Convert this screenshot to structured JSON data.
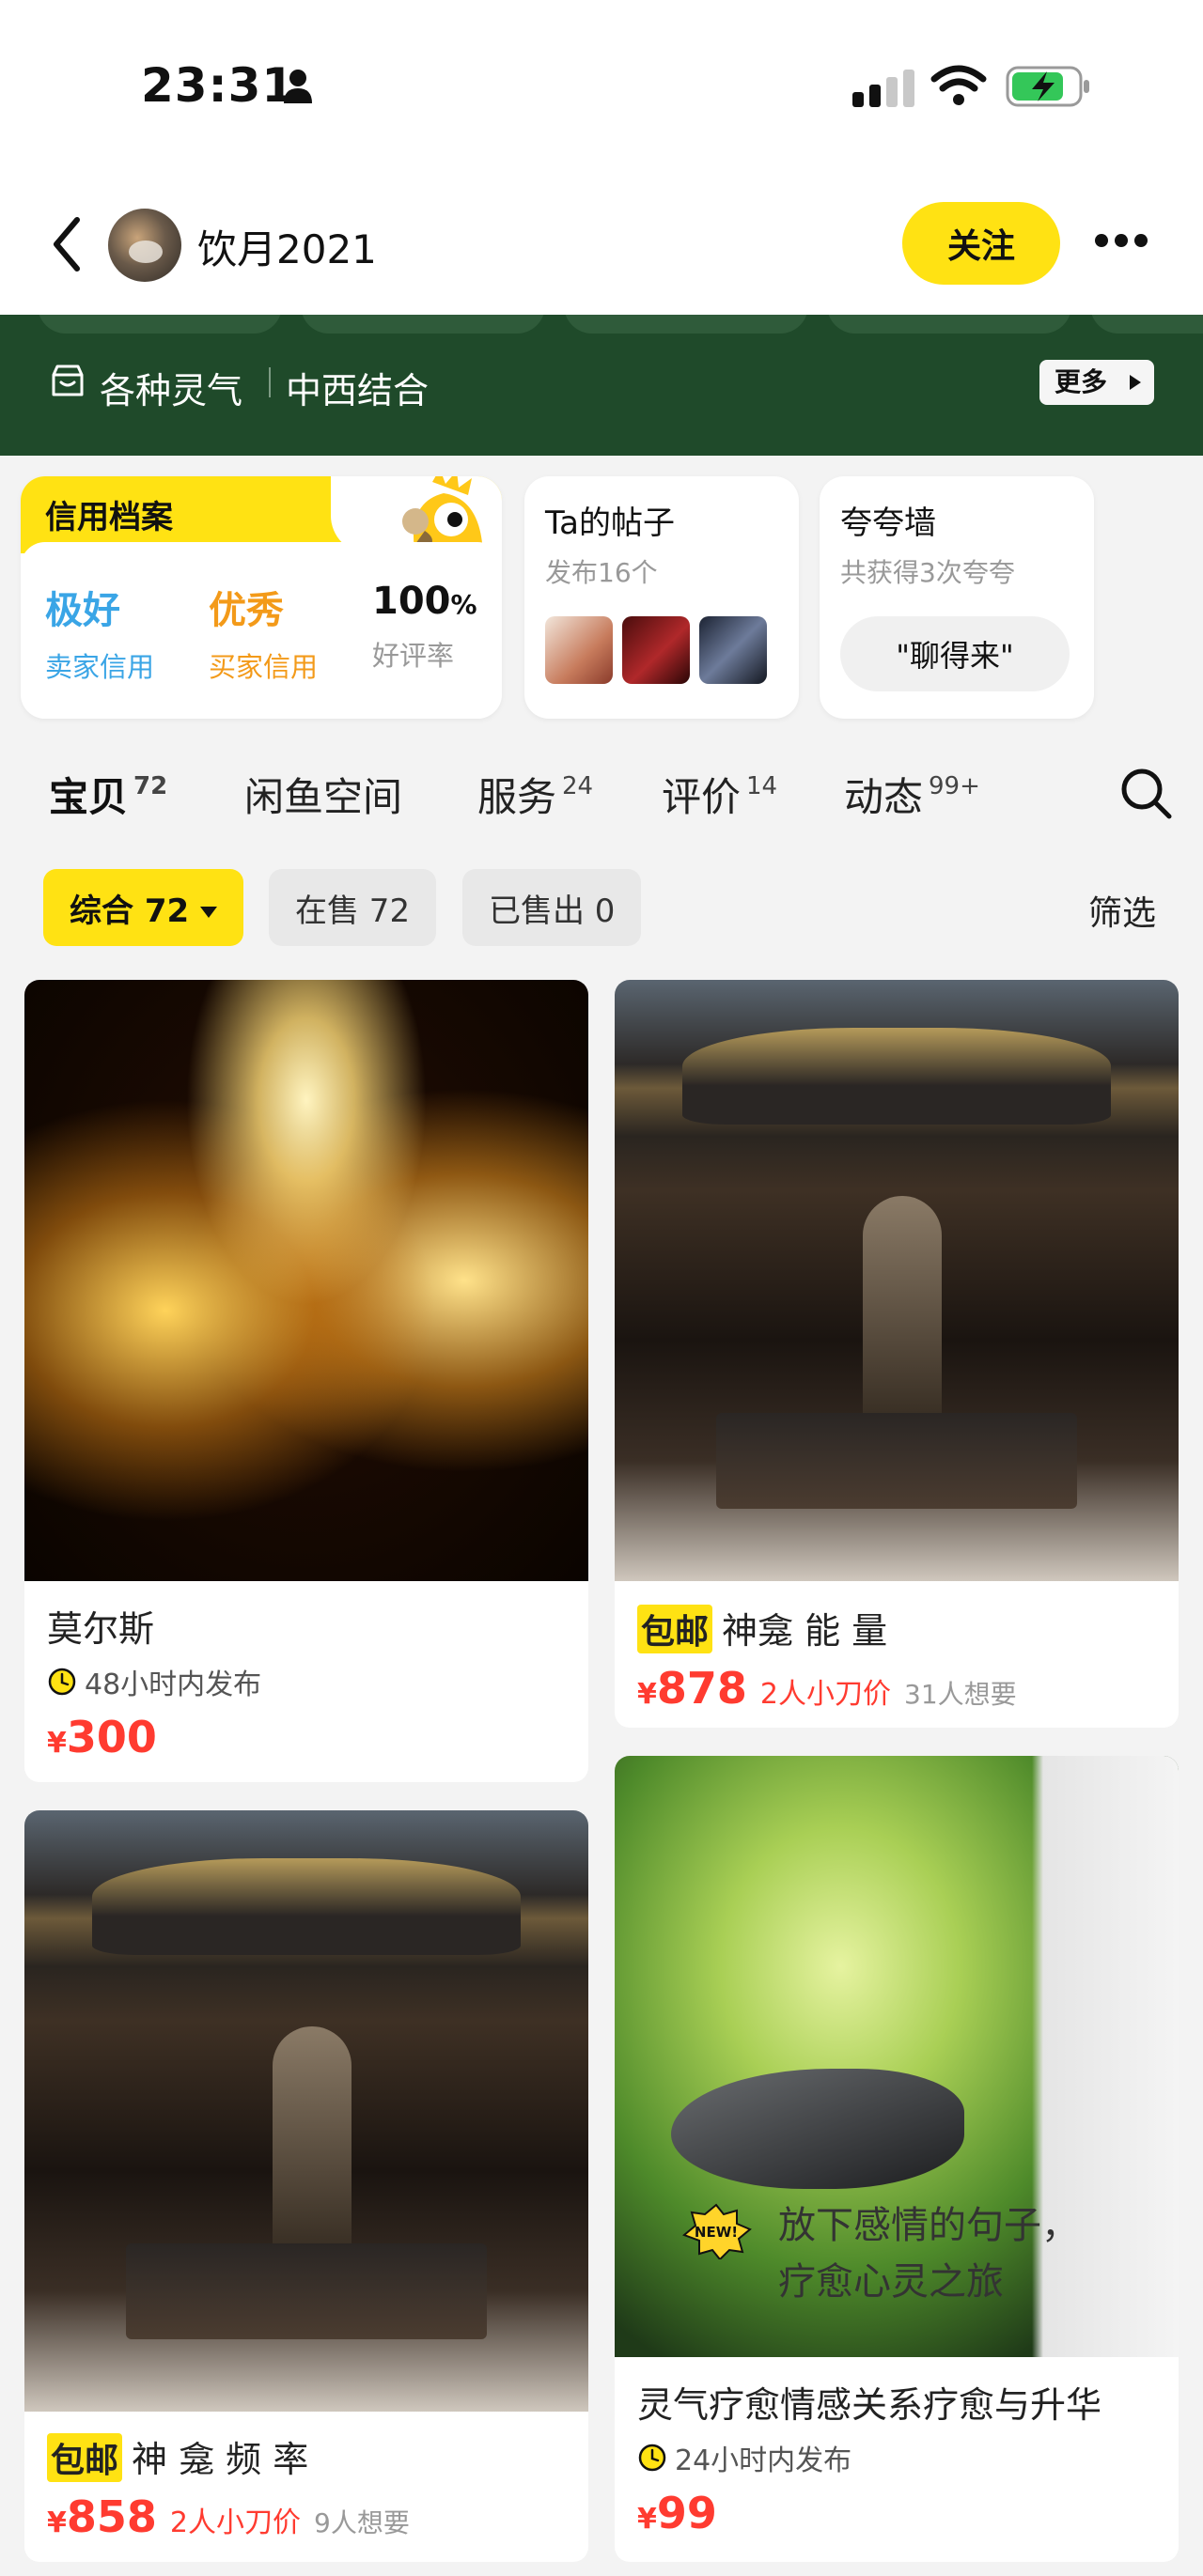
{
  "status_bar": {
    "time": "23:31"
  },
  "nav": {
    "username": "饮月2021",
    "follow_label": "关注"
  },
  "banner": {
    "tag1": "各种灵气",
    "tag2": "中西结合",
    "more_label": "更多"
  },
  "credit": {
    "title": "信用档案",
    "seller_grade": "极好",
    "seller_label": "卖家信用",
    "buyer_grade": "优秀",
    "buyer_label": "买家信用",
    "rating_value": "100",
    "rating_unit": "%",
    "rating_label": "好评率"
  },
  "posts": {
    "title": "Ta的帖子",
    "subtitle": "发布16个"
  },
  "praise": {
    "title": "夸夸墙",
    "subtitle": "共获得3次夸夸",
    "button_label": "\"聊得来\""
  },
  "tabs": [
    {
      "label": "宝贝",
      "count": "72"
    },
    {
      "label": "闲鱼空间",
      "count": ""
    },
    {
      "label": "服务",
      "count": "24"
    },
    {
      "label": "评价",
      "count": "14"
    },
    {
      "label": "动态",
      "count": "99+"
    }
  ],
  "filters": {
    "chips": [
      "综合 72",
      "在售 72",
      "已售出 0"
    ],
    "filter_label": "筛选"
  },
  "products": [
    {
      "title": "莫尔斯",
      "meta": "48小时内发布",
      "currency": "¥",
      "price": "300"
    },
    {
      "tag": "包邮",
      "title": "神龛 能 量",
      "currency": "¥",
      "price": "878",
      "cut": "2人小刀价",
      "want": "31人想要"
    },
    {
      "tag": "包邮",
      "title": "神 龛 频 率",
      "currency": "¥",
      "price": "858",
      "cut": "2人小刀价",
      "want": "9人想要"
    },
    {
      "title": "灵气疗愈情感关系疗愈与升华",
      "meta": "24小时内发布",
      "currency": "¥",
      "price": "99",
      "image_text": "放下感情的句子，疗愈心灵之旅",
      "badge": "NEW!"
    }
  ],
  "colors": {
    "accent_yellow": "#ffe213",
    "banner_green": "#1f4a2a",
    "price_red": "#ff3b30",
    "seller_blue": "#3aa5e6",
    "buyer_orange": "#f39a19"
  }
}
